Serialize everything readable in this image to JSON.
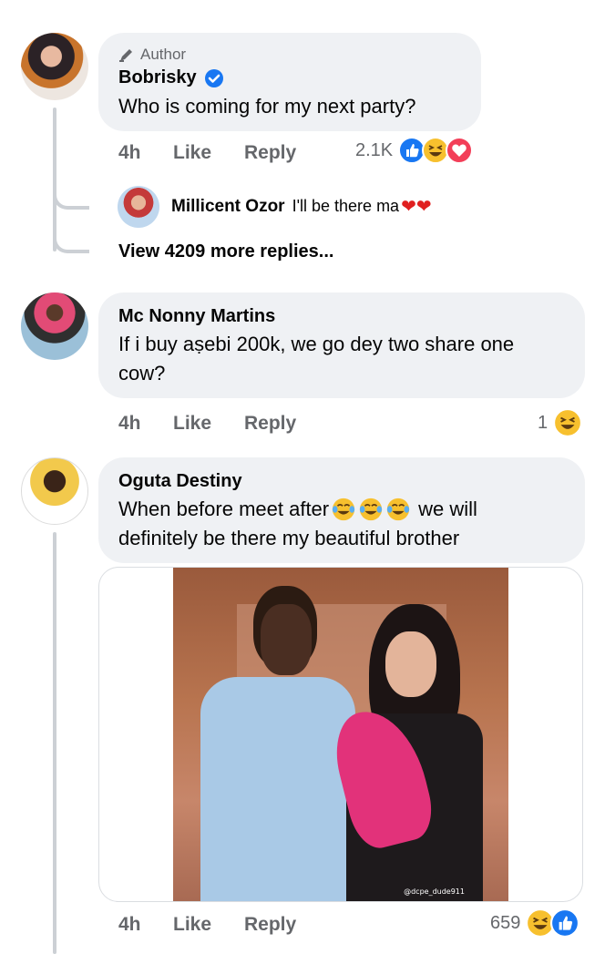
{
  "colors": {
    "bubble": "#eff1f4",
    "meta": "#65676b",
    "like_blue": "#1877f2",
    "haha_yellow": "#f7c02e",
    "love_red": "#f33e58"
  },
  "comments": [
    {
      "author_tag": "Author",
      "name": "Bobrisky",
      "verified": true,
      "text": "Who is coming for my next party?",
      "time": "4h",
      "like": "Like",
      "reply": "Reply",
      "reaction_count": "2.1K",
      "reactions": [
        "like-icon",
        "haha-icon",
        "love-icon"
      ],
      "reply_preview": {
        "name": "Millicent Ozor",
        "text": "I'll be there ma"
      },
      "view_more": "View 4209 more replies..."
    },
    {
      "name": "Mc Nonny Martins",
      "text_line1": "If i buy aṣebi 200k, we go dey two share one",
      "text_line2": "cow?",
      "time": "4h",
      "like": "Like",
      "reply": "Reply",
      "reaction_count": "1",
      "reactions": [
        "haha-icon"
      ]
    },
    {
      "name": "Oguta Destiny",
      "text_line1": "When before meet after",
      "text_line1b": "we will",
      "text_line2": "definitely be there my beautiful brother",
      "image_watermark": "@dcpe_dude911",
      "time": "4h",
      "like": "Like",
      "reply": "Reply",
      "reaction_count": "659",
      "reactions": [
        "haha-icon",
        "like-icon"
      ]
    }
  ]
}
